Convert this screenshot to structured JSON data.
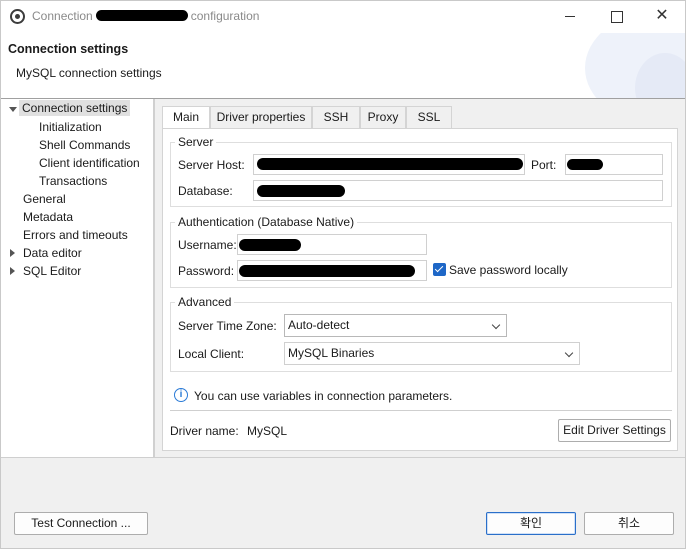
{
  "window": {
    "title_prefix": "Connection",
    "title_suffix": "configuration"
  },
  "header": {
    "title": "Connection settings",
    "subtitle": "MySQL connection settings"
  },
  "tree": {
    "items": [
      {
        "label": "Connection settings",
        "expanded": true,
        "selected": true
      },
      {
        "label": "Initialization"
      },
      {
        "label": "Shell Commands"
      },
      {
        "label": "Client identification"
      },
      {
        "label": "Transactions"
      },
      {
        "label": "General"
      },
      {
        "label": "Metadata"
      },
      {
        "label": "Errors and timeouts"
      },
      {
        "label": "Data editor",
        "expandable": true
      },
      {
        "label": "SQL Editor",
        "expandable": true
      }
    ]
  },
  "tabs": [
    {
      "label": "Main",
      "active": true
    },
    {
      "label": "Driver properties"
    },
    {
      "label": "SSH"
    },
    {
      "label": "Proxy"
    },
    {
      "label": "SSL"
    }
  ],
  "server": {
    "group_label": "Server",
    "host_label": "Server Host:",
    "port_label": "Port:",
    "database_label": "Database:"
  },
  "auth": {
    "group_label": "Authentication (Database Native)",
    "username_label": "Username:",
    "password_label": "Password:",
    "save_password_label": "Save password locally",
    "save_password_checked": true
  },
  "advanced": {
    "group_label": "Advanced",
    "timezone_label": "Server Time Zone:",
    "timezone_value": "Auto-detect",
    "local_client_label": "Local Client:",
    "local_client_value": "MySQL Binaries"
  },
  "info_text": "You can use variables in connection parameters.",
  "driver": {
    "label": "Driver name:",
    "value": "MySQL",
    "edit_button": "Edit Driver Settings"
  },
  "footer": {
    "test_button": "Test Connection ...",
    "ok_button": "확인",
    "cancel_button": "취소"
  },
  "colors": {
    "accent": "#1e67c7",
    "panel_bg": "#f0f0f0"
  }
}
